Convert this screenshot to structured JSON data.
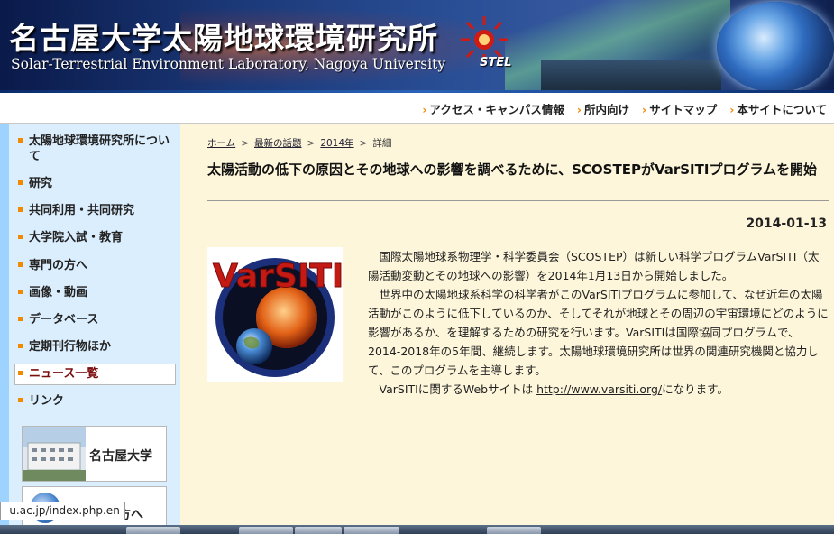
{
  "header": {
    "title_ja": "名古屋大学太陽地球環境研究所",
    "title_en": "Solar-Terrestrial Environment Laboratory, Nagoya University",
    "logo_text": "STEL"
  },
  "topnav": {
    "items": [
      {
        "label": "アクセス・キャンパス情報"
      },
      {
        "label": "所内向け"
      },
      {
        "label": "サイトマップ"
      },
      {
        "label": "本サイトについて"
      }
    ]
  },
  "sidebar": {
    "items": [
      {
        "label": "太陽地球環境研究所について"
      },
      {
        "label": "研究"
      },
      {
        "label": "共同利用・共同研究"
      },
      {
        "label": "大学院入試・教育"
      },
      {
        "label": "専門の方へ"
      },
      {
        "label": "画像・動画"
      },
      {
        "label": "データベース"
      },
      {
        "label": "定期刊行物ほか"
      },
      {
        "label": "ニュース一覧"
      },
      {
        "label": "リンク"
      }
    ],
    "banners": [
      {
        "label": "名古屋大学"
      },
      {
        "label": "の方へ"
      }
    ]
  },
  "breadcrumb": {
    "home": "ホーム",
    "topics": "最新の話題",
    "year": "2014年",
    "current": "詳細",
    "separator": ">"
  },
  "article": {
    "title": "太陽活動の低下の原因とその地球への影響を調べるために、SCOSTEPがVarSITIプログラムを開始",
    "date": "2014-01-13",
    "paragraphs": [
      "国際太陽地球系物理学・科学委員会（SCOSTEP）は新しい科学プログラムVarSITI（太陽活動変動とその地球への影響）を2014年1月13日から開始しました。",
      "世界中の太陽地球系科学の科学者がこのVarSITIプログラムに参加して、なぜ近年の太陽活動がこのように低下しているのか、そしてそれが地球とその周辺の宇宙環境にどのように影響があるか、を理解するための研究を行います。VarSITIは国際協同プログラムで、2014-2018年の5年間、継続します。太陽地球環境研究所は世界の関連研究機関と協力して、このプログラムを主導します。"
    ],
    "link_prefix": "VarSITIに関するWebサイトは ",
    "link_url": "http://www.varsiti.org/",
    "link_suffix": "になります。",
    "image_logo_text": "VarSITI"
  },
  "status_url": "-u.ac.jp/index.php.en",
  "colors": {
    "header_bg": "#1c3a7a",
    "accent_orange": "#f08a00",
    "sidebar_bg": "#dbeefe",
    "sidebar_stripe": "#9fd3ff",
    "main_bg": "#fdf6da",
    "varsiti_red": "#c41a14"
  }
}
